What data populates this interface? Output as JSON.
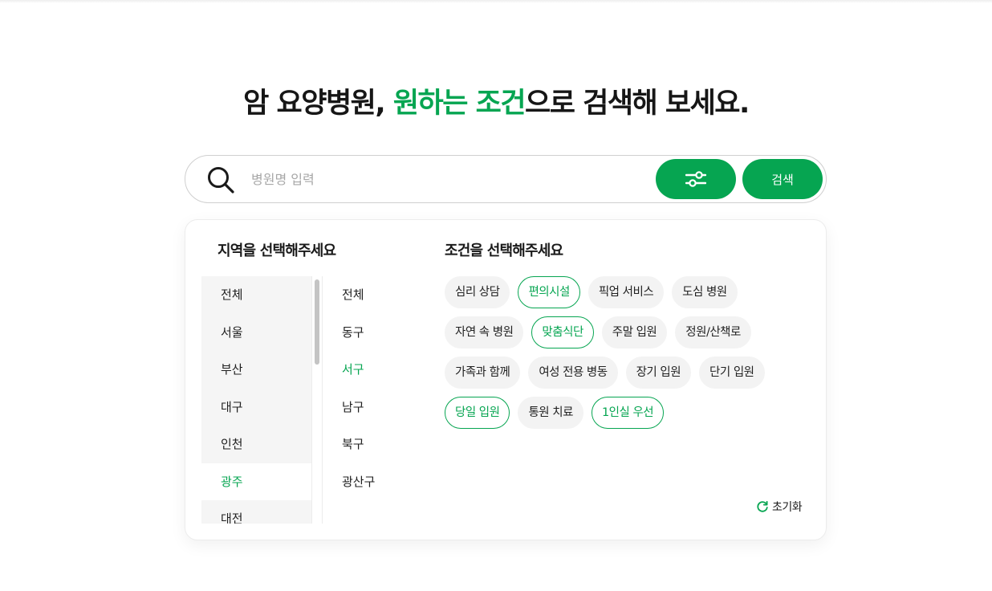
{
  "headline": {
    "prefix": "암 요양병원, ",
    "accent": "원하는 조건",
    "suffix": "으로 검색해 보세요."
  },
  "search": {
    "placeholder": "병원명 입력",
    "submit_label": "검색"
  },
  "colors": {
    "accent": "#06a551",
    "chip_bg": "#f3f3f3",
    "region_bg": "#f5f5f5"
  },
  "icons": {
    "search": "search-icon",
    "filter": "sliders-icon",
    "reset": "refresh-icon"
  },
  "region": {
    "title": "지역을 선택해주세요",
    "items": [
      {
        "label": "전체"
      },
      {
        "label": "서울"
      },
      {
        "label": "부산"
      },
      {
        "label": "대구"
      },
      {
        "label": "인천"
      },
      {
        "label": "광주",
        "selected": true
      },
      {
        "label": "대전"
      }
    ]
  },
  "district": {
    "items": [
      {
        "label": "전체"
      },
      {
        "label": "동구"
      },
      {
        "label": "서구",
        "selected": true
      },
      {
        "label": "남구"
      },
      {
        "label": "북구"
      },
      {
        "label": "광산구"
      }
    ]
  },
  "conditions": {
    "title": "조건을 선택해주세요",
    "rows": [
      [
        {
          "label": "심리 상담"
        },
        {
          "label": "편의시설",
          "active": true
        },
        {
          "label": "픽업 서비스"
        },
        {
          "label": "도심 병원"
        }
      ],
      [
        {
          "label": "자연 속 병원"
        },
        {
          "label": "맞춤식단",
          "active": true
        },
        {
          "label": "주말 입원"
        },
        {
          "label": "정원/산책로"
        }
      ],
      [
        {
          "label": "가족과 함께"
        },
        {
          "label": "여성 전용 병동"
        },
        {
          "label": "장기 입원"
        },
        {
          "label": "단기 입원"
        }
      ],
      [
        {
          "label": "당일 입원",
          "active": true
        },
        {
          "label": "통원 치료"
        },
        {
          "label": "1인실 우선",
          "active": true
        }
      ]
    ]
  },
  "reset_label": "초기화"
}
